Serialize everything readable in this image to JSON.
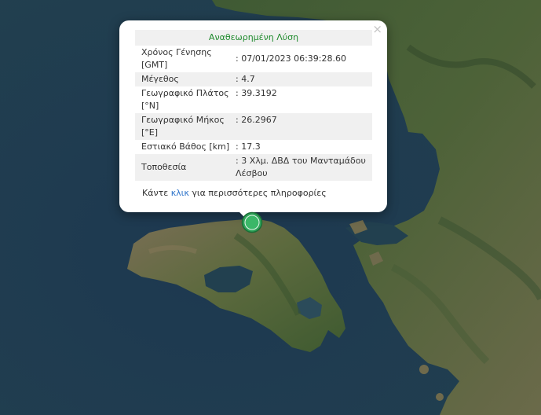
{
  "popup": {
    "title": "Αναθεωρημένη Λύση",
    "close_label": "×",
    "rows": [
      {
        "label": "Χρόνος Γένησης [GMT]",
        "value": ": 07/01/2023 06:39:28.60"
      },
      {
        "label": "Μέγεθος",
        "value": ": 4.7"
      },
      {
        "label": "Γεωγραφικό Πλάτος [°N]",
        "value": ": 39.3192"
      },
      {
        "label": "Γεωγραφικό Μήκος [°E]",
        "value": ": 26.2967"
      },
      {
        "label": "Εστιακό Βάθος [km]",
        "value": ": 17.3"
      },
      {
        "label": "Τοποθεσία",
        "value": ": 3 Χλμ. ΔΒΔ του Μανταμάδου Λέσβου"
      }
    ],
    "more_prefix": "Κάντε ",
    "more_link": "κλικ",
    "more_suffix": " για περισσότερες πληροφορίες"
  },
  "colors": {
    "sea": "#1f3a4d",
    "title_green": "#1e8a2c",
    "link_blue": "#2a72c9",
    "marker_green": "#2fa45a"
  },
  "map": {
    "marker_icon": "earthquake-marker-icon"
  }
}
